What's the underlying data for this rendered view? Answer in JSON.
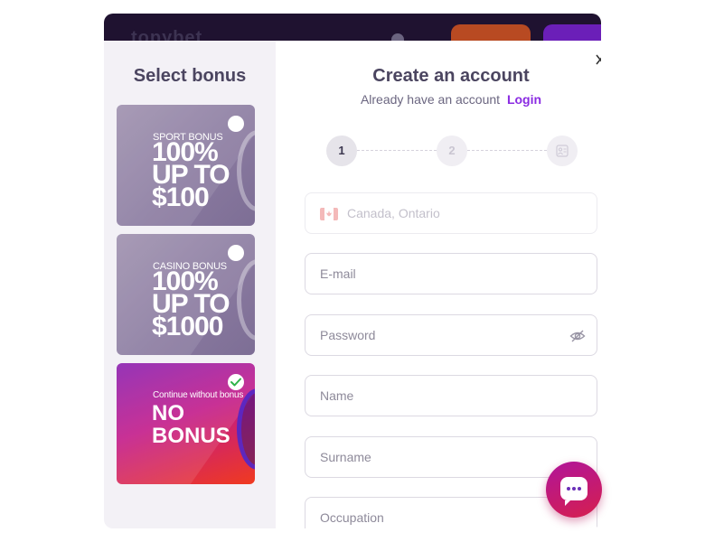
{
  "background": {
    "logo_text": "topybet"
  },
  "bonus_panel": {
    "title": "Select bonus",
    "cards": [
      {
        "label": "SPORT BONUS",
        "headline": "100%\nUP TO\n$100",
        "selected": false
      },
      {
        "label": "CASINO BONUS",
        "headline": "100%\nUP TO\n$1000",
        "selected": false
      },
      {
        "label": "Continue without bonus",
        "headline": "NO\nBONUS",
        "selected": true
      }
    ]
  },
  "form": {
    "title": "Create an account",
    "already_text": "Already have an account",
    "login_label": "Login",
    "steps": [
      "1",
      "2"
    ],
    "active_step": 1,
    "region_value": "Canada, Ontario",
    "email_placeholder": "E-mail",
    "password_placeholder": "Password",
    "name_placeholder": "Name",
    "surname_placeholder": "Surname",
    "occupation_placeholder": "Occupation"
  },
  "icons": {
    "close": "close-icon",
    "eye": "eye-off-icon",
    "chat": "chat-icon",
    "flag": "canada-flag-icon",
    "check": "check-icon",
    "final_step": "id-card-icon"
  },
  "colors": {
    "accent": "#8a2be2",
    "chat_gradient_start": "#b0159a",
    "chat_gradient_end": "#d61f4e"
  }
}
